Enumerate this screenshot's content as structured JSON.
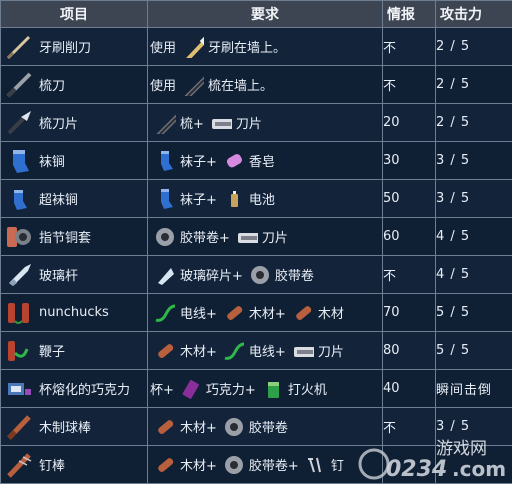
{
  "header": {
    "item": "项目",
    "requirement": "要求",
    "intel": "情报",
    "attack": "攻击力"
  },
  "rows": [
    {
      "icon": "toothbrush-shiv-icon",
      "name": "牙刷削刀",
      "req": [
        {
          "text": "使用"
        },
        {
          "icon": "toothbrush-icon"
        },
        {
          "text": "牙刷在墙上。"
        }
      ],
      "intel": "不",
      "attack": "2 / 5"
    },
    {
      "icon": "comb-blade-icon",
      "name": "梳刀",
      "req": [
        {
          "text": "使用"
        },
        {
          "icon": "comb-icon"
        },
        {
          "text": "梳在墙上。"
        }
      ],
      "intel": "不",
      "attack": "2 / 5"
    },
    {
      "icon": "comb-razor-icon",
      "name": "梳刀片",
      "req": [
        {
          "icon": "comb-icon"
        },
        {
          "text": "梳+"
        },
        {
          "icon": "razor-icon"
        },
        {
          "text": "刀片"
        }
      ],
      "intel": "20",
      "attack": "2 / 5"
    },
    {
      "icon": "sock-mace-icon",
      "name": "袜锏",
      "req": [
        {
          "icon": "sock-icon"
        },
        {
          "text": "袜子+"
        },
        {
          "icon": "soap-icon"
        },
        {
          "text": "香皂"
        }
      ],
      "intel": "30",
      "attack": "3 / 5"
    },
    {
      "icon": "super-sock-mace-icon",
      "name": "超袜锏",
      "req": [
        {
          "icon": "sock-icon"
        },
        {
          "text": "袜子+"
        },
        {
          "icon": "battery-icon"
        },
        {
          "text": "电池"
        }
      ],
      "intel": "50",
      "attack": "3 / 5"
    },
    {
      "icon": "knuckle-duster-icon",
      "name": "指节铜套",
      "req": [
        {
          "icon": "tape-icon"
        },
        {
          "text": "胶带卷+"
        },
        {
          "icon": "razor-icon"
        },
        {
          "text": "刀片"
        }
      ],
      "intel": "60",
      "attack": "4 / 5"
    },
    {
      "icon": "glass-shank-icon",
      "name": "玻璃杆",
      "req": [
        {
          "icon": "glass-shard-icon"
        },
        {
          "text": "玻璃碎片+"
        },
        {
          "icon": "tape-icon"
        },
        {
          "text": "胶带卷"
        }
      ],
      "intel": "不",
      "attack": "4 / 5"
    },
    {
      "icon": "nunchucks-icon",
      "name": "nunchucks",
      "req": [
        {
          "icon": "wire-icon"
        },
        {
          "text": "电线+"
        },
        {
          "icon": "timber-icon"
        },
        {
          "text": "木材+"
        },
        {
          "icon": "timber-icon"
        },
        {
          "text": "木材"
        }
      ],
      "intel": "70",
      "attack": "5 / 5"
    },
    {
      "icon": "whip-icon",
      "name": "鞭子",
      "req": [
        {
          "icon": "timber-icon"
        },
        {
          "text": "木材+"
        },
        {
          "icon": "wire-icon"
        },
        {
          "text": "电线+"
        },
        {
          "icon": "razor-icon"
        },
        {
          "text": "刀片"
        }
      ],
      "intel": "80",
      "attack": "5 / 5"
    },
    {
      "icon": "cup-of-molten-chocolate-icon",
      "name": "杯熔化的巧克力",
      "req": [
        {
          "text": "杯+"
        },
        {
          "icon": "chocolate-icon"
        },
        {
          "text": "巧克力+"
        },
        {
          "icon": "lighter-icon"
        },
        {
          "text": "打火机"
        }
      ],
      "intel": "40",
      "attack": "瞬间击倒"
    },
    {
      "icon": "wooden-bat-icon",
      "name": "木制球棒",
      "req": [
        {
          "icon": "timber-icon"
        },
        {
          "text": "木材+"
        },
        {
          "icon": "tape-icon"
        },
        {
          "text": "胶带卷"
        }
      ],
      "intel": "不",
      "attack": "3 / 5"
    },
    {
      "icon": "nail-bat-icon",
      "name": "钉棒",
      "req": [
        {
          "icon": "timber-icon"
        },
        {
          "text": "木材+"
        },
        {
          "icon": "tape-icon"
        },
        {
          "text": "胶带卷+"
        },
        {
          "icon": "nails-icon"
        },
        {
          "text": "钉"
        }
      ],
      "intel": "",
      "attack": ""
    }
  ],
  "watermark": {
    "domain": "0234",
    "suffix": ".com",
    "site": "游戏网"
  },
  "colors": {
    "header_bg": "#3d4552",
    "row_bg": "#12233a",
    "border": "#6e7d90",
    "text": "#e8eef6"
  }
}
